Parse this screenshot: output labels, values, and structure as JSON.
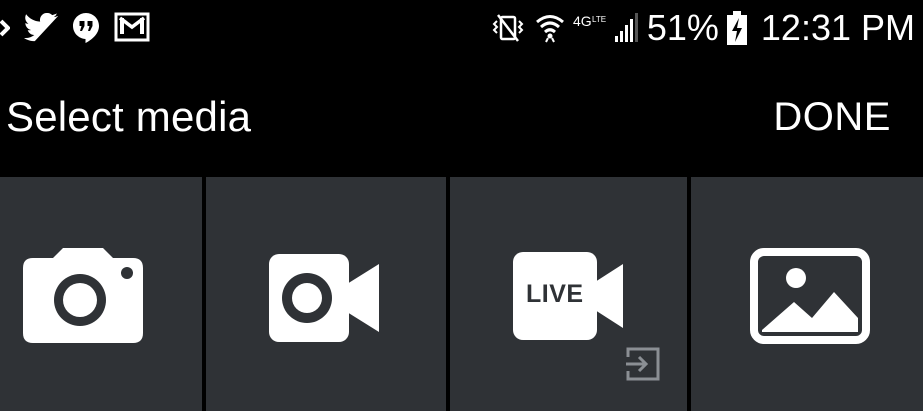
{
  "status_bar": {
    "notification_icons": [
      "missed-call-icon",
      "twitter-icon",
      "hangouts-icon",
      "gmail-icon"
    ],
    "system_icons": [
      "vibrate-icon",
      "wifi-icon",
      "lte-icon",
      "signal-icon"
    ],
    "battery_percent_text": "51%",
    "battery_icon": "battery-charging-icon",
    "time": "12:31 PM"
  },
  "header": {
    "title": "Select media",
    "done_label": "DONE"
  },
  "media_options": [
    {
      "icon": "camera-icon"
    },
    {
      "icon": "video-camera-icon"
    },
    {
      "icon": "live-video-icon",
      "badge_text": "LIVE",
      "secondary_icon": "share-to-icon"
    },
    {
      "icon": "image-gallery-icon"
    }
  ],
  "colors": {
    "background": "#000000",
    "tile_background": "#2f3236",
    "text": "#ffffff",
    "secondary_icon": "#8b8f94"
  }
}
